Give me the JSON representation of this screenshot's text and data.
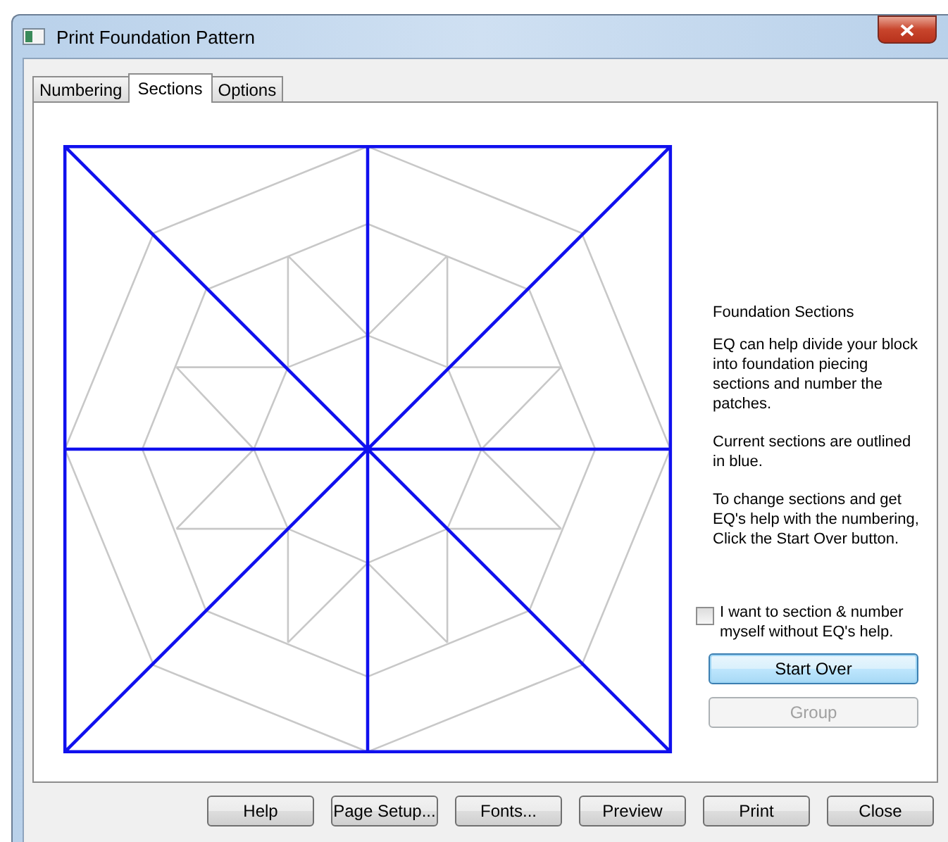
{
  "window": {
    "title": "Print Foundation Pattern"
  },
  "tabs": [
    {
      "label": "Numbering",
      "selected": false
    },
    {
      "label": "Sections",
      "selected": true
    },
    {
      "label": "Options",
      "selected": false
    }
  ],
  "info": {
    "heading": "Foundation Sections",
    "paragraphs": [
      "EQ can help divide your block into foundation piecing sections and number the patches.",
      "Current sections are outlined in blue.",
      "To change sections and get EQ's help with the numbering, Click the Start Over button."
    ]
  },
  "manual_checkbox": {
    "label": "I want to section & number myself without EQ's help.",
    "checked": false
  },
  "section_buttons": [
    {
      "label": "Start Over",
      "disabled": false,
      "focused": true
    },
    {
      "label": "Group",
      "disabled": true,
      "focused": false
    }
  ],
  "footer_buttons": [
    "Help",
    "Page Setup...",
    "Fonts...",
    "Preview",
    "Print",
    "Close"
  ]
}
